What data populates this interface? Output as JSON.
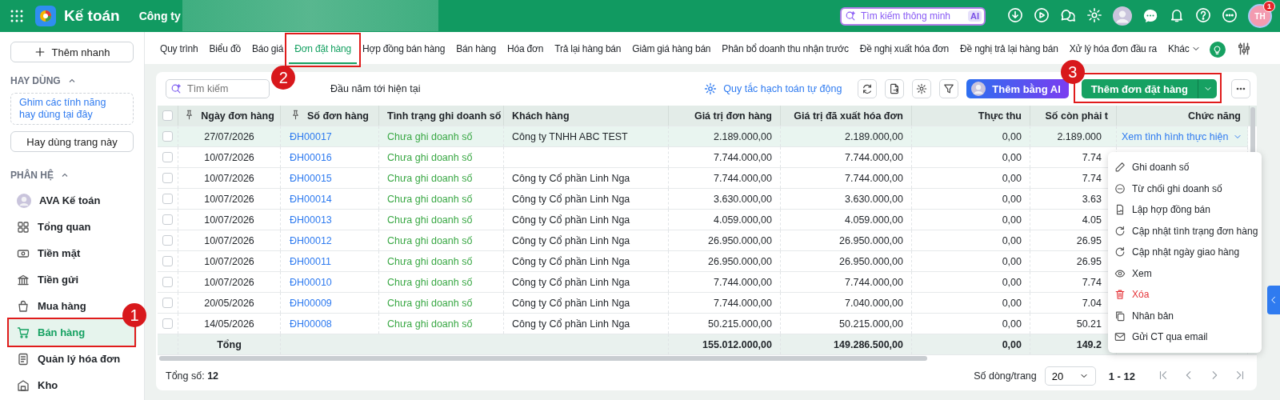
{
  "topbar": {
    "app_name": "Kế toán",
    "company": "Công ty",
    "search": {
      "placeholder": "Tìm kiếm thông minh",
      "badge": "AI"
    },
    "user": {
      "initials": "TH",
      "badge": "1"
    }
  },
  "sidebar": {
    "quick_add": "Thêm nhanh",
    "favorites": {
      "title": "HAY DÙNG",
      "expanded": true,
      "hint": "Ghim các tính năng hay dùng tại đây",
      "button": "Hay dùng trang này"
    },
    "modules": {
      "title": "PHÂN HỆ",
      "expanded": true,
      "items": [
        {
          "label": "AVA Kế toán",
          "selected": false
        },
        {
          "label": "Tổng quan",
          "selected": false
        },
        {
          "label": "Tiền mặt",
          "selected": false
        },
        {
          "label": "Tiền gửi",
          "selected": false
        },
        {
          "label": "Mua hàng",
          "selected": false
        },
        {
          "label": "Bán hàng",
          "selected": true,
          "callout": "1"
        },
        {
          "label": "Quản lý hóa đơn",
          "selected": false
        },
        {
          "label": "Kho",
          "selected": false
        }
      ]
    }
  },
  "tabs": [
    {
      "label": "Quy trình",
      "selected": false
    },
    {
      "label": "Biểu đồ",
      "selected": false
    },
    {
      "label": "Báo giá",
      "selected": false
    },
    {
      "label": "Đơn đặt hàng",
      "selected": true,
      "callout": "2"
    },
    {
      "label": "Hợp đồng bán hàng",
      "selected": false
    },
    {
      "label": "Bán hàng",
      "selected": false
    },
    {
      "label": "Hóa đơn",
      "selected": false
    },
    {
      "label": "Trả lại hàng bán",
      "selected": false
    },
    {
      "label": "Giảm giá hàng bán",
      "selected": false
    },
    {
      "label": "Phân bổ doanh thu nhận trước",
      "selected": false
    },
    {
      "label": "Đề nghị xuất hóa đơn",
      "selected": false
    },
    {
      "label": "Đề nghị trả lại hàng bán",
      "selected": false
    },
    {
      "label": "Xử lý hóa đơn đầu ra",
      "selected": false
    }
  ],
  "more_tab": {
    "label": "Khác"
  },
  "toolbar": {
    "search_placeholder": "Tìm kiếm",
    "period": "Đầu năm tới hiện tại",
    "rules_link": "Quy tắc hạch toán tự động",
    "ai_button": "Thêm bằng AI",
    "add_button": {
      "label": "Thêm đơn đặt hàng",
      "callout": "3"
    }
  },
  "table": {
    "select_all_checked": false,
    "columns": [
      {
        "label": "Ngày đơn hàng",
        "pinned": true
      },
      {
        "label": "Số đơn hàng",
        "pinned": true
      },
      {
        "label": "Tình trạng ghi doanh số",
        "pinned": false
      },
      {
        "label": "Khách hàng",
        "pinned": false
      },
      {
        "label": "Giá trị đơn hàng",
        "pinned": false
      },
      {
        "label": "Giá trị đã xuất hóa đơn",
        "pinned": false
      },
      {
        "label": "Thực thu",
        "pinned": false
      },
      {
        "label": "Số còn phải t",
        "pinned": false
      },
      {
        "label": "Chức năng",
        "pinned": false
      }
    ],
    "rows": [
      {
        "date": "27/07/2026",
        "number": "ĐH00017",
        "status": "Chưa ghi doanh số",
        "customer": "Công ty TNHH ABC TEST",
        "order_value": "2.189.000,00",
        "invoiced_value": "2.189.000,00",
        "received": "0,00",
        "remaining": "2.189.000",
        "action": "Xem tình hình thực hiện",
        "selected": true,
        "checked": false
      },
      {
        "date": "10/07/2026",
        "number": "ĐH00016",
        "status": "Chưa ghi doanh số",
        "order_value": "7.744.000,00",
        "invoiced_value": "7.744.000,00",
        "received": "0,00",
        "remaining": "7.74",
        "selected": false,
        "checked": false
      },
      {
        "date": "10/07/2026",
        "number": "ĐH00015",
        "status": "Chưa ghi doanh số",
        "customer": "Công ty Cổ phần Linh Nga",
        "order_value": "7.744.000,00",
        "invoiced_value": "7.744.000,00",
        "received": "0,00",
        "remaining": "7.74",
        "selected": false,
        "checked": false
      },
      {
        "date": "10/07/2026",
        "number": "ĐH00014",
        "status": "Chưa ghi doanh số",
        "customer": "Công ty Cổ phần Linh Nga",
        "order_value": "3.630.000,00",
        "invoiced_value": "3.630.000,00",
        "received": "0,00",
        "remaining": "3.63",
        "selected": false,
        "checked": false
      },
      {
        "date": "10/07/2026",
        "number": "ĐH00013",
        "status": "Chưa ghi doanh số",
        "customer": "Công ty Cổ phần Linh Nga",
        "order_value": "4.059.000,00",
        "invoiced_value": "4.059.000,00",
        "received": "0,00",
        "remaining": "4.05",
        "selected": false,
        "checked": false
      },
      {
        "date": "10/07/2026",
        "number": "ĐH00012",
        "status": "Chưa ghi doanh số",
        "customer": "Công ty Cổ phần Linh Nga",
        "order_value": "26.950.000,00",
        "invoiced_value": "26.950.000,00",
        "received": "0,00",
        "remaining": "26.95",
        "selected": false,
        "checked": false
      },
      {
        "date": "10/07/2026",
        "number": "ĐH00011",
        "status": "Chưa ghi doanh số",
        "customer": "Công ty Cổ phần Linh Nga",
        "order_value": "26.950.000,00",
        "invoiced_value": "26.950.000,00",
        "received": "0,00",
        "remaining": "26.95",
        "selected": false,
        "checked": false
      },
      {
        "date": "10/07/2026",
        "number": "ĐH00010",
        "status": "Chưa ghi doanh số",
        "customer": "Công ty Cổ phần Linh Nga",
        "order_value": "7.744.000,00",
        "invoiced_value": "7.744.000,00",
        "received": "0,00",
        "remaining": "7.74",
        "selected": false,
        "checked": false
      },
      {
        "date": "20/05/2026",
        "number": "ĐH00009",
        "status": "Chưa ghi doanh số",
        "customer": "Công ty Cổ phần Linh Nga",
        "order_value": "7.744.000,00",
        "invoiced_value": "7.040.000,00",
        "received": "0,00",
        "remaining": "7.04",
        "selected": false,
        "checked": false
      },
      {
        "date": "14/05/2026",
        "number": "ĐH00008",
        "status": "Chưa ghi doanh số",
        "customer": "Công ty Cổ phần Linh Nga",
        "order_value": "50.215.000,00",
        "invoiced_value": "50.215.000,00",
        "received": "0,00",
        "remaining": "50.21",
        "selected": false,
        "checked": false
      }
    ],
    "totals": {
      "label": "Tổng",
      "order_value": "155.012.000,00",
      "invoiced_value": "149.286.500,00",
      "received": "0,00",
      "remaining": "149.2"
    }
  },
  "action_menu": {
    "items": [
      {
        "label": "Ghi doanh số",
        "kind": "normal"
      },
      {
        "label": "Từ chối ghi doanh số",
        "kind": "normal"
      },
      {
        "label": "Lập hợp đồng bán",
        "kind": "normal"
      },
      {
        "label": "Cập nhật tình trạng đơn hàng",
        "kind": "normal"
      },
      {
        "label": "Cập nhật ngày giao hàng",
        "kind": "normal"
      },
      {
        "label": "Xem",
        "kind": "normal"
      },
      {
        "label": "Xóa",
        "kind": "danger"
      },
      {
        "label": "Nhân bản",
        "kind": "normal"
      },
      {
        "label": "Gửi CT qua email",
        "kind": "normal"
      }
    ]
  },
  "footer": {
    "total": "Tổng số: **12**",
    "page_size_label": "Số dòng/trang",
    "page_size": "20",
    "range": "1 - 12"
  }
}
